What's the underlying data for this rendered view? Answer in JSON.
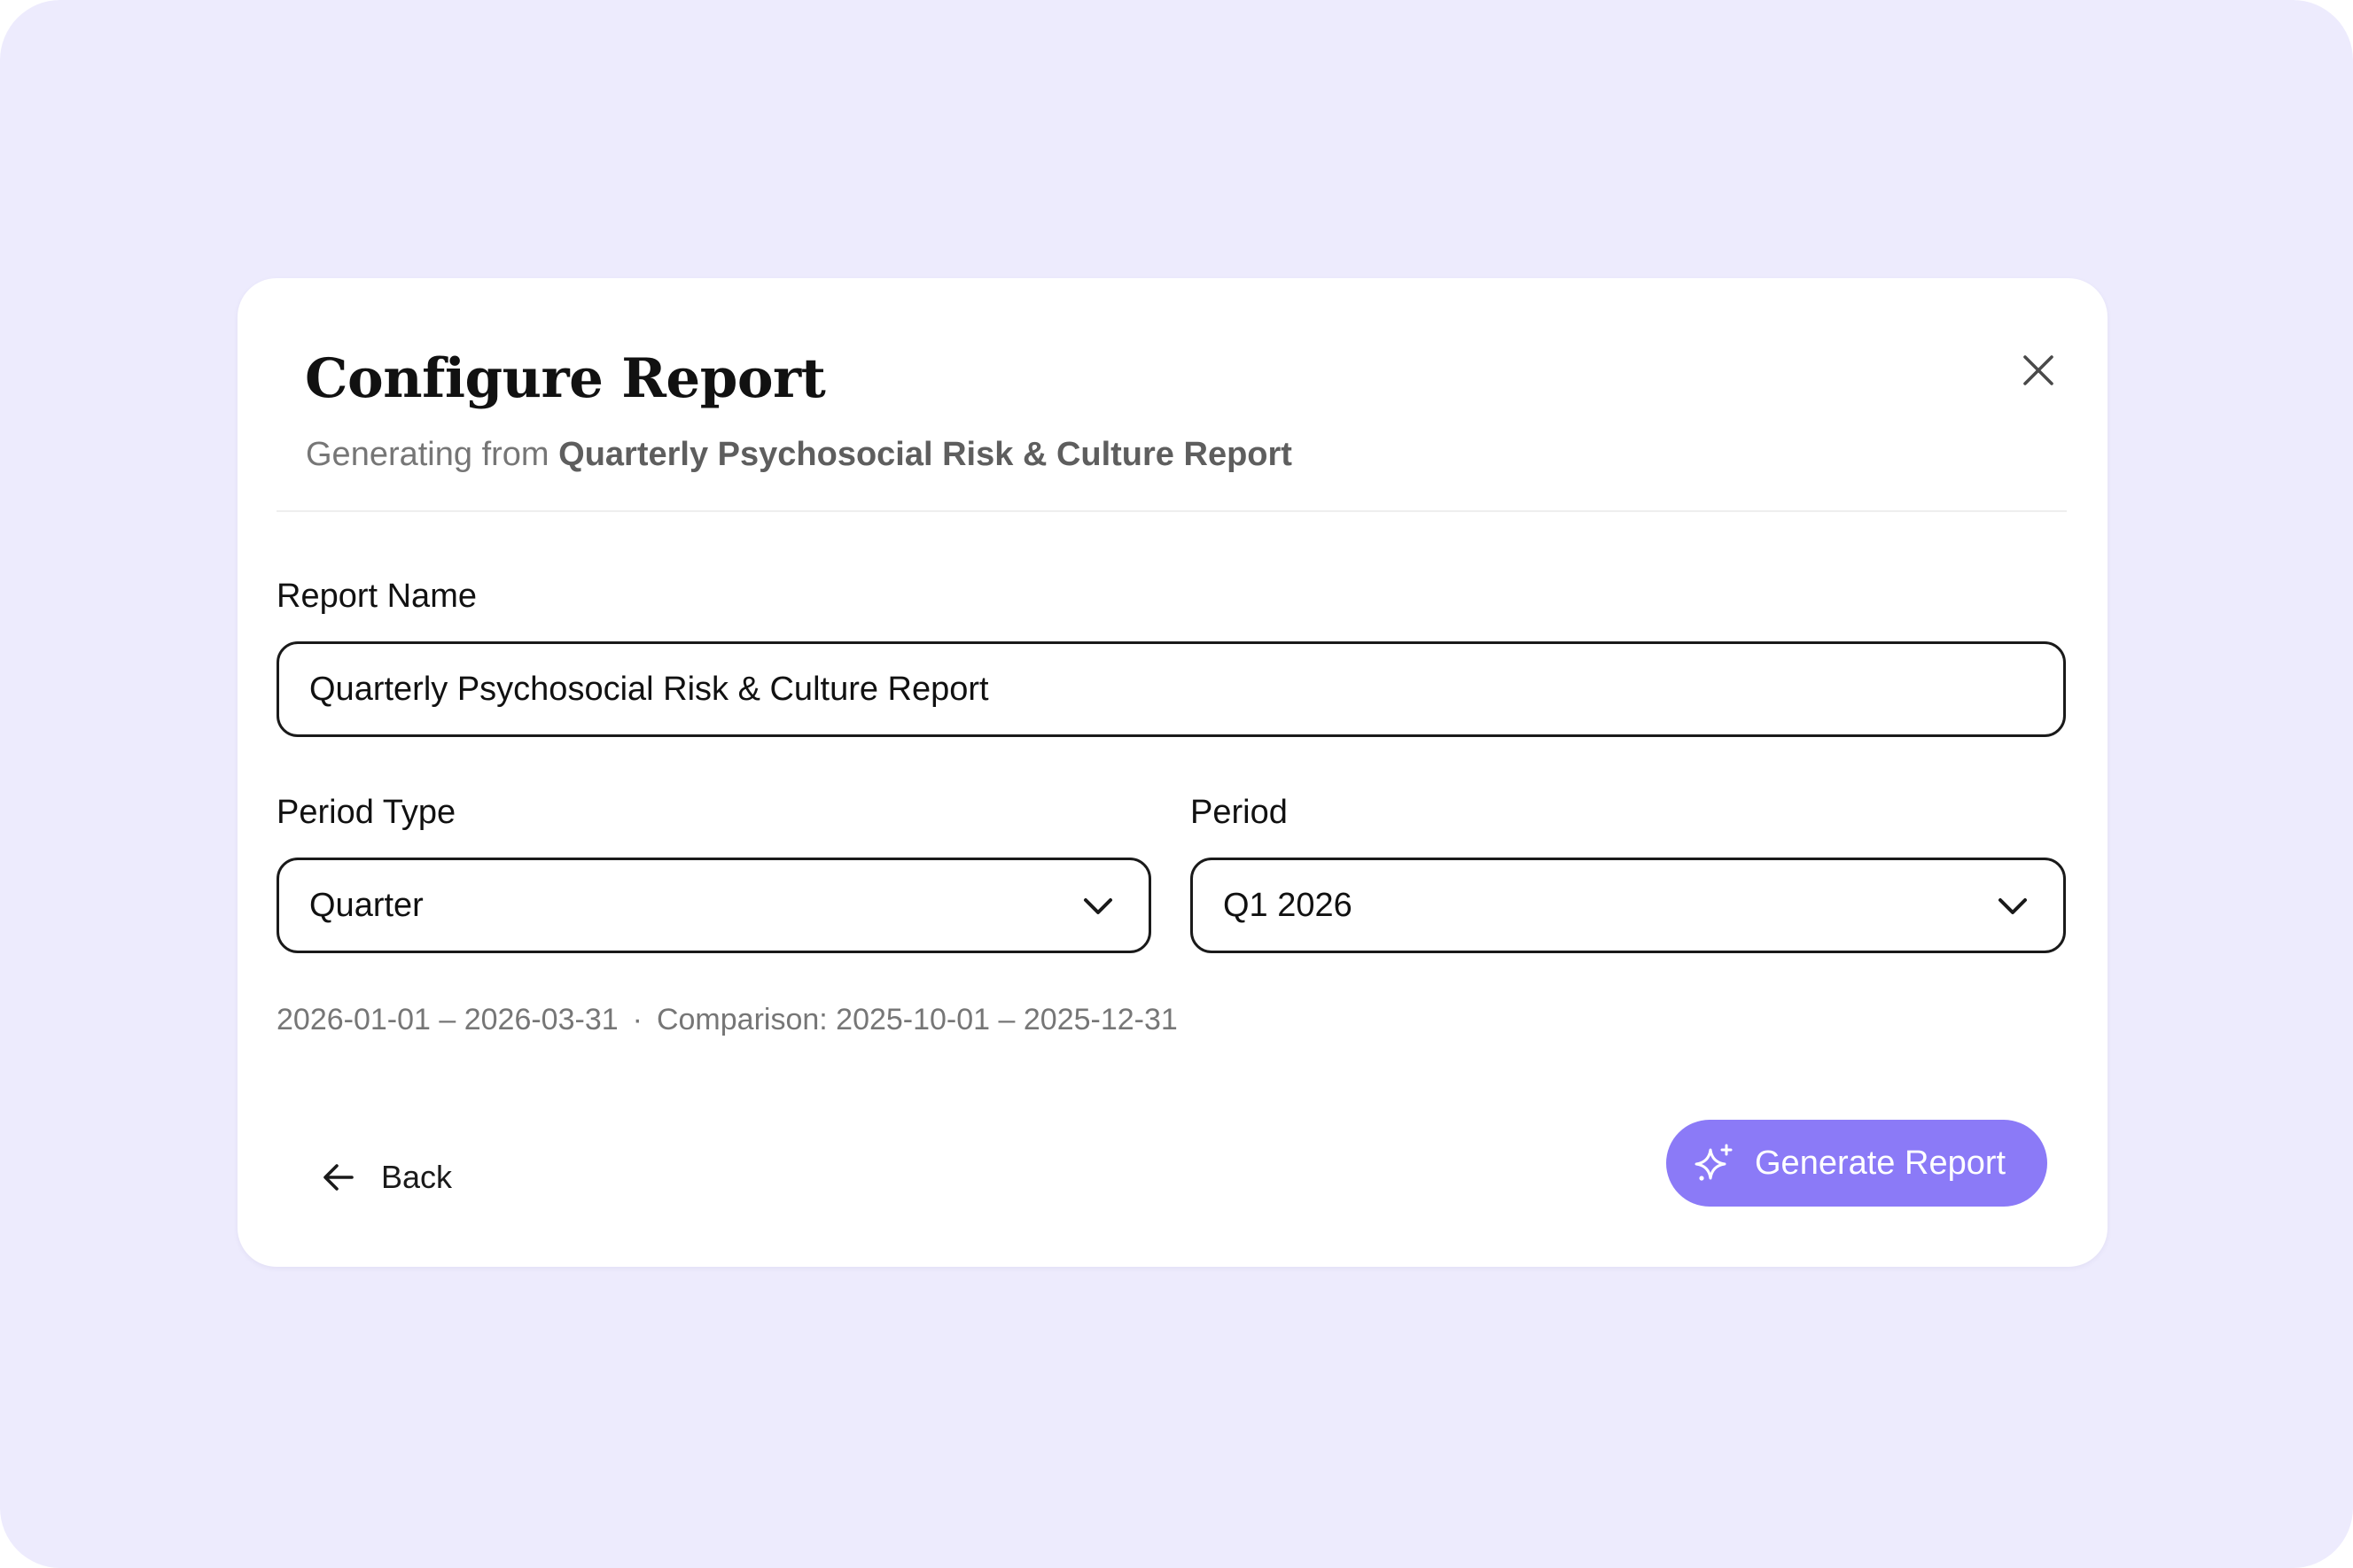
{
  "dialog": {
    "title": "Configure Report",
    "subtitle_prefix": "Generating from",
    "subtitle_source": "Quarterly Psychosocial Risk & Culture Report"
  },
  "form": {
    "report_name_label": "Report Name",
    "report_name_value": "Quarterly Psychosocial Risk & Culture Report",
    "period_type_label": "Period Type",
    "period_type_value": "Quarter",
    "period_label": "Period",
    "period_value": "Q1 2026",
    "date_range": "2026-01-01 – 2026-03-31",
    "separator": "·",
    "comparison": "Comparison: 2025-10-01 – 2025-12-31"
  },
  "actions": {
    "back_label": "Back",
    "generate_label": "Generate Report"
  },
  "icons": {
    "close": "close-icon",
    "period_type_chevron": "chevron-down-icon",
    "period_chevron": "chevron-down-icon",
    "back": "arrow-left-icon",
    "generate": "sparkle-icon"
  },
  "colors": {
    "background": "#edebfd",
    "dialog": "#ffffff",
    "accent": "#8b7af7",
    "text_primary": "#111111",
    "text_muted": "#767676",
    "border": "#1a1a1a"
  }
}
